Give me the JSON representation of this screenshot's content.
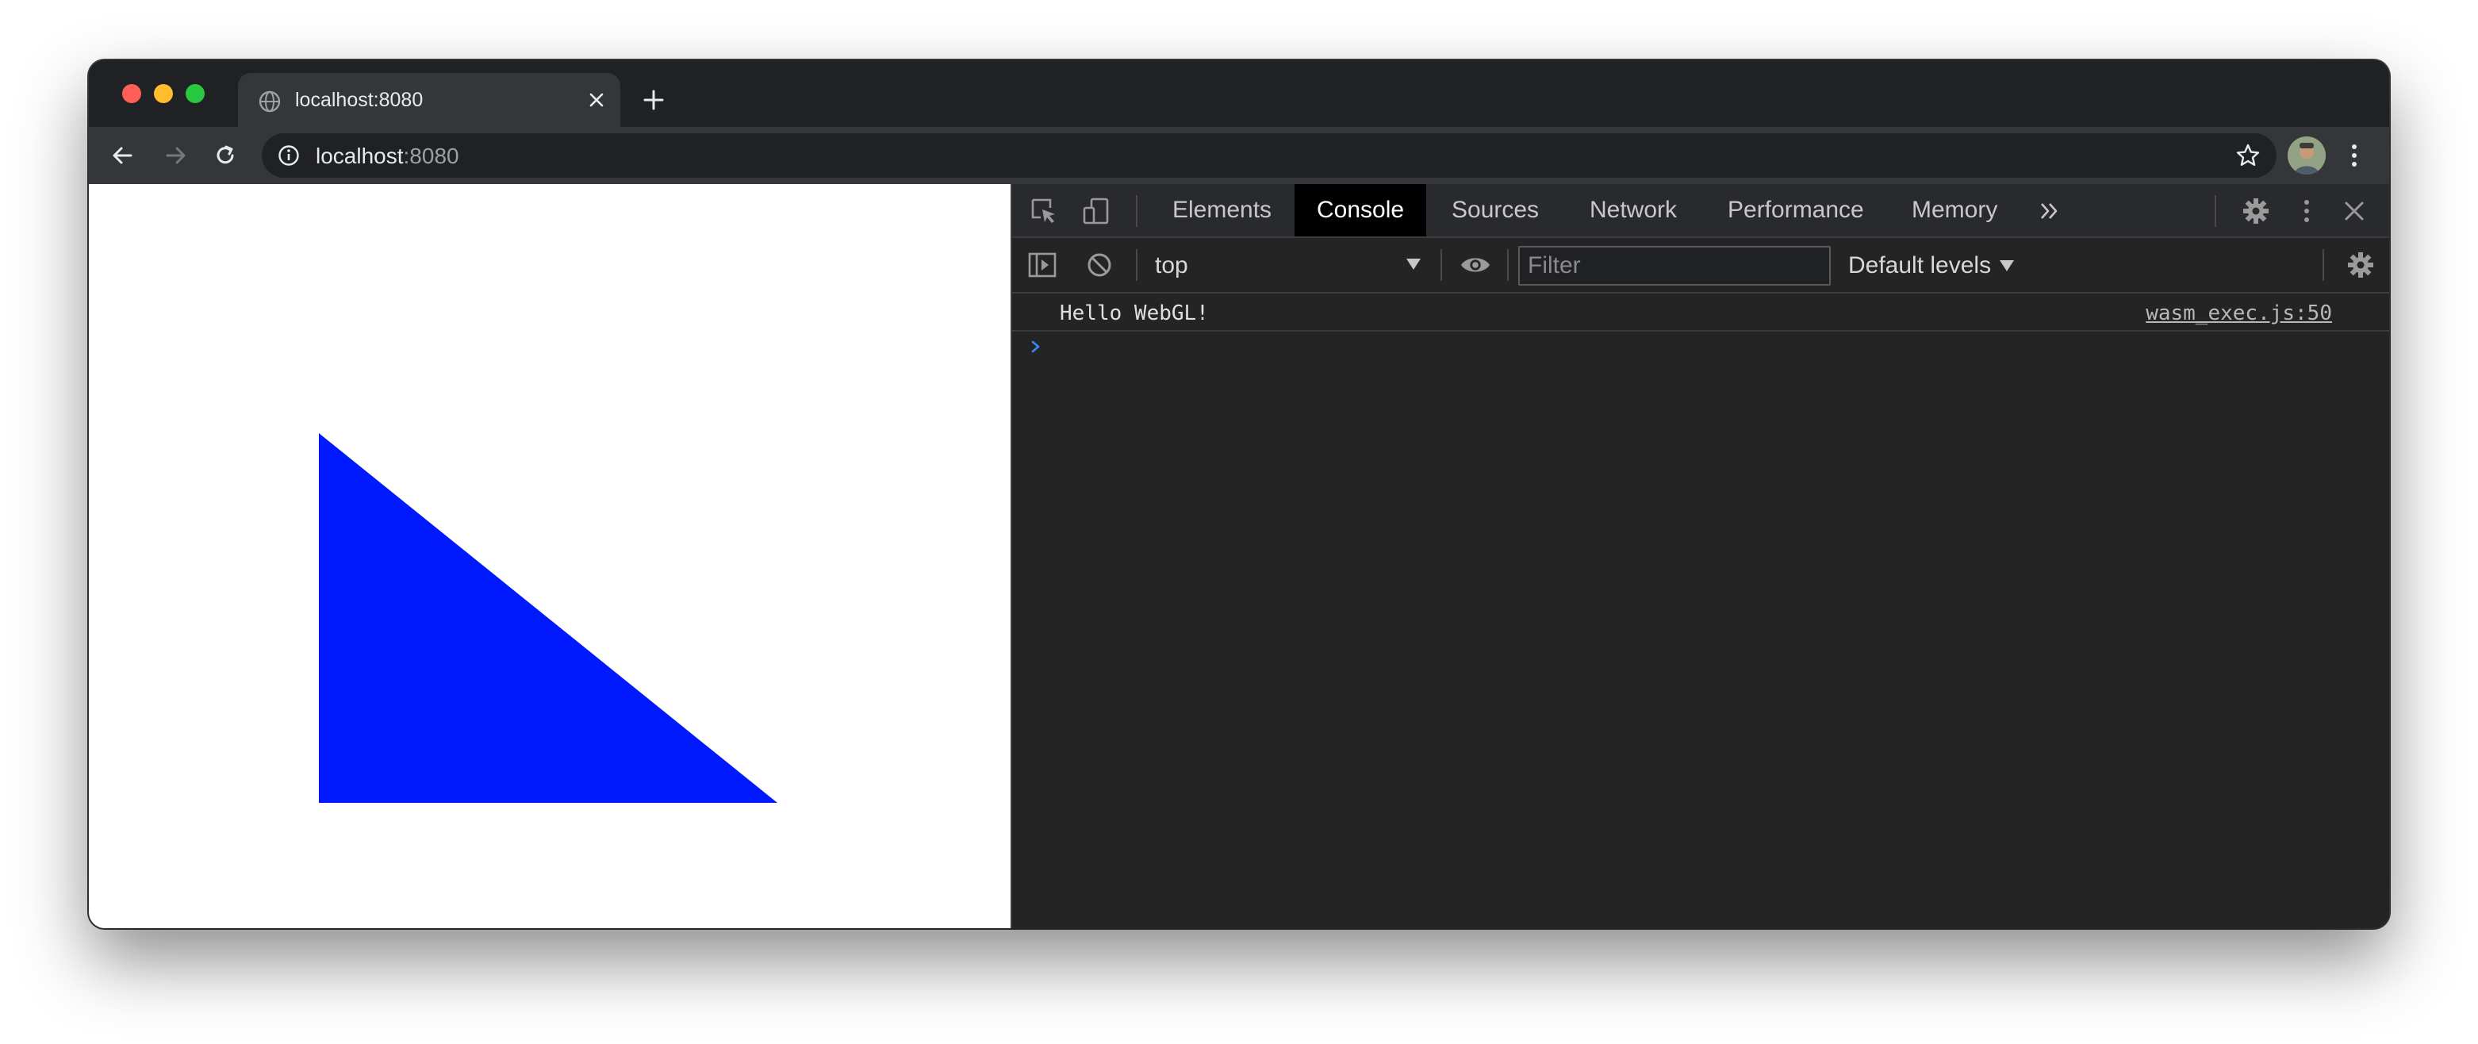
{
  "browser": {
    "tab": {
      "title": "localhost:8080"
    },
    "address_bar": {
      "host": "localhost",
      "port": ":8080"
    }
  },
  "page": {
    "shape": "triangle",
    "fill_color": "#0019ff",
    "background": "#ffffff"
  },
  "devtools": {
    "tabs": [
      {
        "label": "Elements",
        "active": false
      },
      {
        "label": "Console",
        "active": true
      },
      {
        "label": "Sources",
        "active": false
      },
      {
        "label": "Network",
        "active": false
      },
      {
        "label": "Performance",
        "active": false
      },
      {
        "label": "Memory",
        "active": false
      }
    ],
    "console_toolbar": {
      "context": "top",
      "filter_placeholder": "Filter",
      "levels": "Default levels"
    },
    "messages": [
      {
        "text": "Hello WebGL!",
        "source": "wasm_exec.js:50"
      }
    ]
  },
  "colors": {
    "accent_blue": "#3b87f5",
    "traffic_red": "#ff5f57",
    "traffic_yellow": "#febc2e",
    "traffic_green": "#28c840"
  }
}
